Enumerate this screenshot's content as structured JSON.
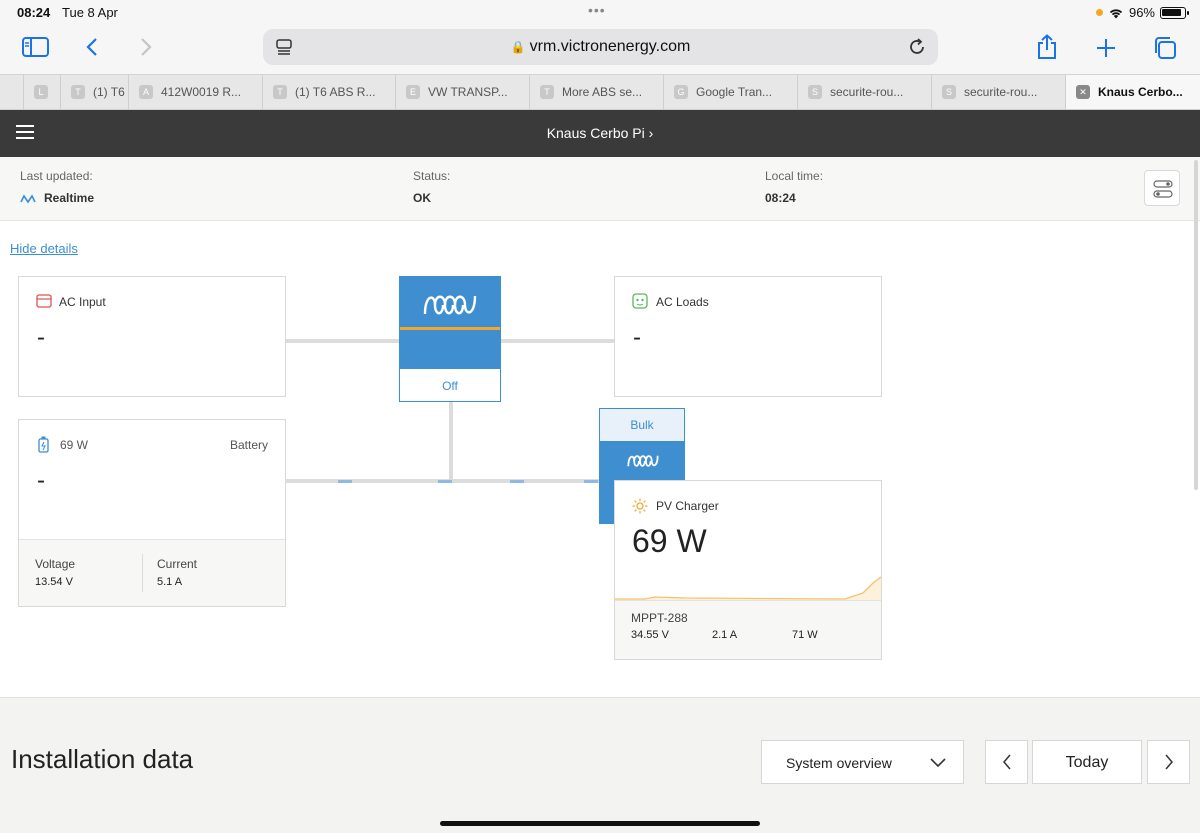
{
  "status_bar": {
    "time": "08:24",
    "date": "Tue 8 Apr",
    "battery_pct": "96%"
  },
  "browser": {
    "url": "vrm.victronenergy.com",
    "tabs": [
      {
        "fav": "L",
        "title": ""
      },
      {
        "fav": "T",
        "title": "(1) T6"
      },
      {
        "fav": "A",
        "title": "412W0019 R..."
      },
      {
        "fav": "T",
        "title": "(1) T6 ABS R..."
      },
      {
        "fav": "E",
        "title": "VW TRANSP..."
      },
      {
        "fav": "T",
        "title": "More ABS se..."
      },
      {
        "fav": "G",
        "title": "Google Tran..."
      },
      {
        "fav": "S",
        "title": "securite-rou..."
      },
      {
        "fav": "S",
        "title": "securite-rou..."
      },
      {
        "fav": "✕",
        "title": "Knaus Cerbo..."
      }
    ]
  },
  "app": {
    "title": "Knaus Cerbo Pi",
    "last_updated_label": "Last updated:",
    "last_updated_value": "Realtime",
    "status_label": "Status:",
    "status_value": "OK",
    "local_time_label": "Local time:",
    "local_time_value": "08:24",
    "hide_details": "Hide details"
  },
  "diagram": {
    "ac_input": {
      "label": "AC Input",
      "value": "-"
    },
    "ac_loads": {
      "label": "AC Loads",
      "value": "-"
    },
    "inverter": {
      "state": "Off"
    },
    "battery": {
      "power": "69 W",
      "label": "Battery",
      "value": "-",
      "voltage_label": "Voltage",
      "voltage_value": "13.54 V",
      "current_label": "Current",
      "current_value": "5.1 A"
    },
    "mppt_state": "Bulk",
    "pv_charger": {
      "label": "PV Charger",
      "value": "69 W",
      "device": "MPPT-288",
      "voltage": "34.55 V",
      "current": "2.1 A",
      "power": "71 W"
    }
  },
  "installation": {
    "heading": "Installation data",
    "view_select": "System overview",
    "period": "Today"
  },
  "colors": {
    "brand_blue": "#3f8fd0",
    "accent_orange": "#f0a830",
    "header_dark": "#3a3a3a"
  }
}
